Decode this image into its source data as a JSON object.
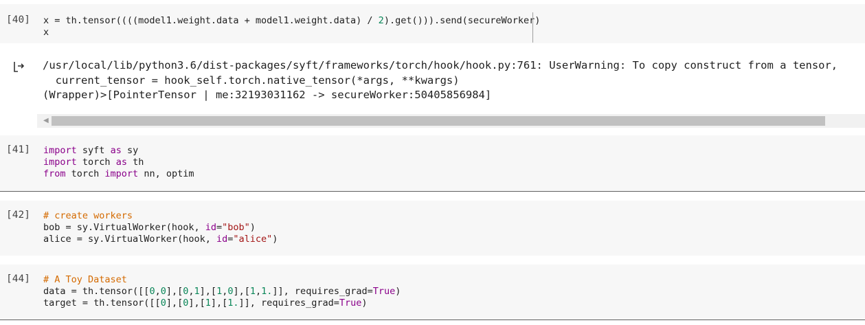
{
  "cells": {
    "c40": {
      "count": "[40]",
      "lines": [
        "x = th.tensor((((model1.weight.data + model1.weight.data) / 2).get())).send(secureWorker)",
        "x"
      ],
      "output_lines": [
        "/usr/local/lib/python3.6/dist-packages/syft/frameworks/torch/hook/hook.py:761: UserWarning: To copy construct from a tensor,",
        "  current_tensor = hook_self.torch.native_tensor(*args, **kwargs)",
        "(Wrapper)>[PointerTensor | me:32193031162 -> secureWorker:50405856984]"
      ]
    },
    "c41": {
      "count": "[41]",
      "lines": [
        "import syft as sy",
        "import torch as th",
        "from torch import nn, optim"
      ]
    },
    "c42": {
      "count": "[42]",
      "lines": [
        "# create workers",
        "bob = sy.VirtualWorker(hook, id=\"bob\")",
        "alice = sy.VirtualWorker(hook, id=\"alice\")"
      ]
    },
    "c44": {
      "count": "[44]",
      "lines": [
        "# A Toy Dataset",
        "data = th.tensor([[0,0],[0,1],[1,0],[1,1.]], requires_grad=True)",
        "target = th.tensor([[0],[0],[1],[1.]], requires_grad=True)"
      ]
    }
  },
  "icons": {
    "output": "output-arrow-icon",
    "scroll_left": "scroll-left-arrow-icon"
  },
  "colors": {
    "keyword": "#8a008a",
    "string": "#a31515",
    "number": "#098658",
    "comment": "#d46a00",
    "cell_background": "#f7f7f7"
  }
}
